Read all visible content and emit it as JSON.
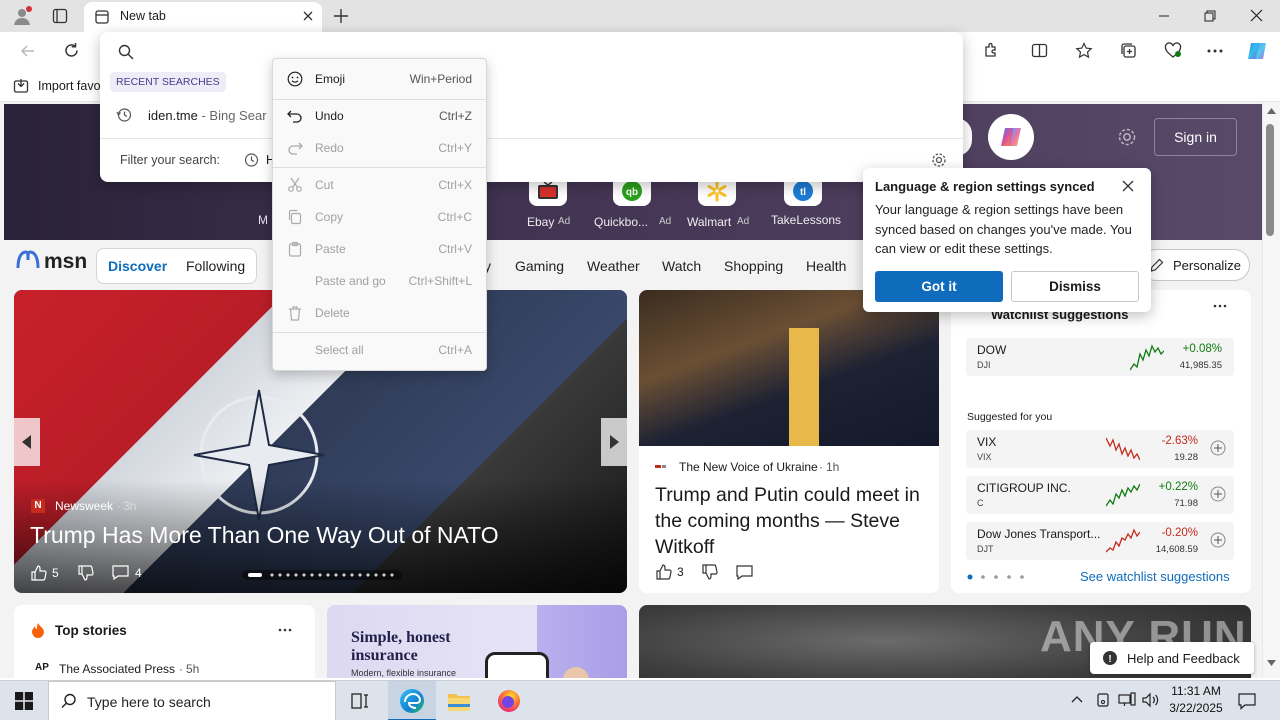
{
  "browser": {
    "tab_title": "New tab",
    "favorites_bar": {
      "import_label": "Import favo"
    },
    "omnibox": {
      "recent_header": "RECENT SEARCHES",
      "recent_item_text": "iden.tme",
      "recent_item_suffix": " - Bing Sear",
      "filter_label": "Filter your search:",
      "filter_history_label": "H"
    }
  },
  "context_menu": {
    "items": [
      {
        "label": "Emoji",
        "shortcut": "Win+Period",
        "enabled": true,
        "icon": "emoji-icon"
      },
      {
        "label": "Undo",
        "shortcut": "Ctrl+Z",
        "enabled": true,
        "icon": "undo-icon"
      },
      {
        "label": "Redo",
        "shortcut": "Ctrl+Y",
        "enabled": false,
        "icon": "redo-icon"
      },
      {
        "label": "Cut",
        "shortcut": "Ctrl+X",
        "enabled": false,
        "icon": "cut-icon"
      },
      {
        "label": "Copy",
        "shortcut": "Ctrl+C",
        "enabled": false,
        "icon": "copy-icon"
      },
      {
        "label": "Paste",
        "shortcut": "Ctrl+V",
        "enabled": false,
        "icon": "paste-icon"
      },
      {
        "label": "Paste and go",
        "shortcut": "Ctrl+Shift+L",
        "enabled": false,
        "icon": "paste-go-icon"
      },
      {
        "label": "Delete",
        "shortcut": "",
        "enabled": false,
        "icon": "delete-icon"
      },
      {
        "label": "Select all",
        "shortcut": "Ctrl+A",
        "enabled": false,
        "icon": ""
      }
    ]
  },
  "newtab": {
    "sign_in": "Sign in",
    "quick_links": [
      {
        "label": "Ebay",
        "ad": "Ad",
        "color": "#d9322c"
      },
      {
        "label": "Quickbo...",
        "ad": "Ad",
        "color": "#2ca01c"
      },
      {
        "label": "Walmart",
        "ad": "Ad",
        "color": "#0071dc"
      },
      {
        "label": "TakeLessons",
        "ad": "",
        "color": "#1d7bd6"
      }
    ],
    "partial_link_label": "M",
    "msn_logo": "msn",
    "tabs": {
      "discover": "Discover",
      "following": "Following"
    },
    "nav_partial": "y",
    "nav": [
      "Gaming",
      "Weather",
      "Watch",
      "Shopping",
      "Health"
    ],
    "personalize": "Personalize"
  },
  "sync_popup": {
    "title": "Language & region settings synced",
    "body": "Your language & region settings have been synced based on changes you've made. You can view or edit these settings.",
    "got_it": "Got it",
    "dismiss": "Dismiss"
  },
  "hero_story": {
    "source": "Newsweek",
    "time": "3h",
    "headline": "Trump Has More Than One Way Out of NATO",
    "likes": "5",
    "comments": "4"
  },
  "second_story": {
    "source": "The New Voice of Ukraine",
    "time": "1h",
    "headline": "Trump and Putin could meet in the coming months — Steve Witkoff",
    "likes": "3"
  },
  "watchlist": {
    "title": "Watchlist suggestions",
    "top": {
      "name": "DOW",
      "ticker": "DJI",
      "change": "+0.08%",
      "value": "41,985.35"
    },
    "suggested_label": "Suggested for you",
    "items": [
      {
        "name": "VIX",
        "ticker": "VIX",
        "change": "-2.63%",
        "value": "19.28",
        "up": false
      },
      {
        "name": "CITIGROUP INC.",
        "ticker": "C",
        "change": "+0.22%",
        "value": "71.98",
        "up": true
      },
      {
        "name": "Dow Jones Transport...",
        "ticker": "DJT",
        "change": "-0.20%",
        "value": "14,608.59",
        "up": false
      }
    ],
    "see_more": "See watchlist suggestions"
  },
  "top_stories": {
    "title": "Top stories",
    "first_source": "The Associated Press",
    "first_time": "5h",
    "source_badge": "AP"
  },
  "ad_card": {
    "headline": "Simple, honest insurance",
    "sub": "Modern, flexible insurance"
  },
  "help_feedback": "Help and Feedback",
  "watermark": "ANY RUN",
  "taskbar": {
    "search_placeholder": "Type here to search",
    "time": "11:31 AM",
    "date": "3/22/2025"
  },
  "colors": {
    "accent": "#0f6cbd",
    "got_it_bg": "#0f6cbd",
    "red": "#c42b1c",
    "green": "#0f7b0f"
  }
}
